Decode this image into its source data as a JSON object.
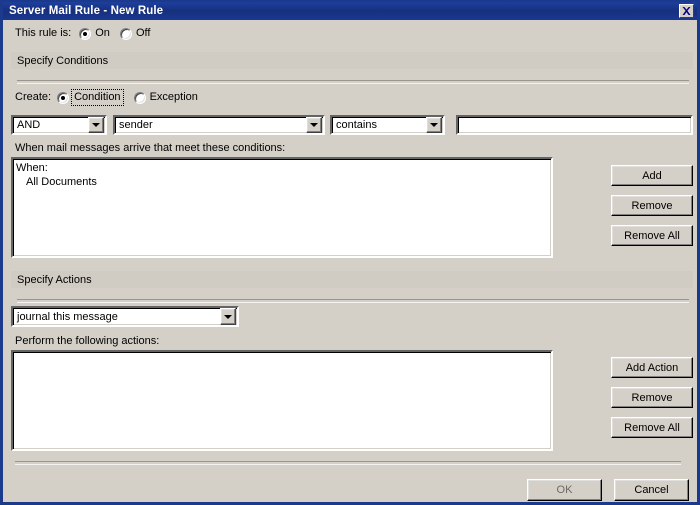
{
  "window": {
    "title": "Server Mail Rule - New Rule",
    "close_icon": "close-icon",
    "close_glyph": "✖",
    "accent_titlebar": "#1c3a8c",
    "face_color": "#d4d0c8"
  },
  "rule_state": {
    "label": "This rule is:",
    "options": [
      {
        "label": "On",
        "selected": true
      },
      {
        "label": "Off",
        "selected": false
      }
    ]
  },
  "conditions": {
    "section_title": "Specify Conditions",
    "create_label": "Create:",
    "create_options": [
      {
        "label": "Condition",
        "selected": true,
        "focused": true
      },
      {
        "label": "Exception",
        "selected": false,
        "focused": false
      }
    ],
    "operator_combo": {
      "value": "AND",
      "arrow_icon": "chevron-down-icon"
    },
    "field_combo": {
      "value": "sender",
      "arrow_icon": "chevron-down-icon"
    },
    "comparator_combo": {
      "value": "contains",
      "arrow_icon": "chevron-down-icon"
    },
    "value_input": {
      "value": "",
      "placeholder": ""
    },
    "list_label": "When mail messages arrive that meet these conditions:",
    "list_items": [
      {
        "text": "When:",
        "indent": false
      },
      {
        "text": "All Documents",
        "indent": true
      }
    ],
    "buttons": [
      {
        "label": "Add",
        "name": "add-condition-button"
      },
      {
        "label": "Remove",
        "name": "remove-condition-button"
      },
      {
        "label": "Remove All",
        "name": "remove-all-conditions-button"
      }
    ]
  },
  "actions": {
    "section_title": "Specify Actions",
    "action_combo": {
      "value": "journal this message",
      "arrow_icon": "chevron-down-icon"
    },
    "list_label": "Perform the following actions:",
    "list_items": [],
    "buttons": [
      {
        "label": "Add Action",
        "name": "add-action-button"
      },
      {
        "label": "Remove",
        "name": "remove-action-button"
      },
      {
        "label": "Remove All",
        "name": "remove-all-actions-button"
      }
    ]
  },
  "footer": {
    "ok_label": "OK",
    "cancel_label": "Cancel"
  }
}
